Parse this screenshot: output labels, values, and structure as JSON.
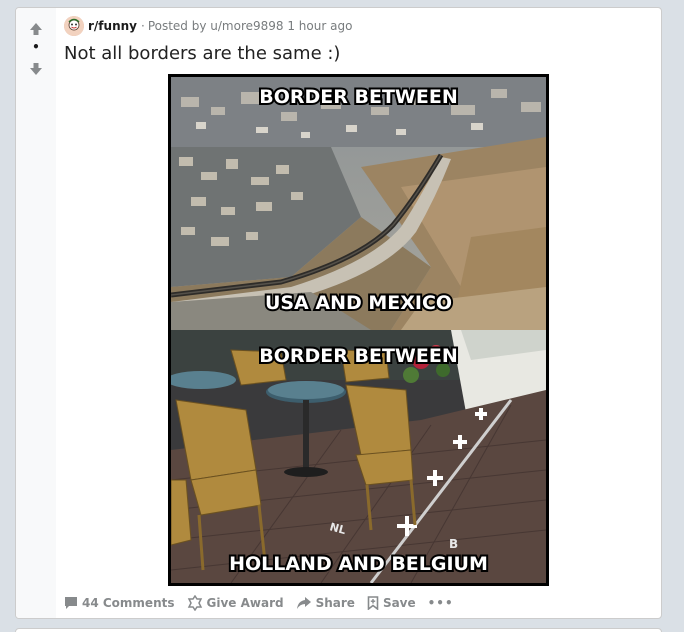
{
  "post": {
    "subreddit": "r/funny",
    "separator": "·",
    "posted_by": "Posted by u/more9898 1 hour ago",
    "score": "•",
    "title": "Not all borders are the same :)"
  },
  "meme": {
    "top_heading": "BORDER BETWEEN",
    "top_subject": "USA AND MEXICO",
    "bottom_heading": "BORDER BETWEEN",
    "bottom_subject": "HOLLAND AND BELGIUM",
    "ground_mark_nl": "NL",
    "ground_mark_b": "B"
  },
  "actions": {
    "comments": "44 Comments",
    "award": "Give Award",
    "share": "Share",
    "save": "Save",
    "more": "•••"
  },
  "colors": {
    "page_bg": "#dae0e6",
    "card_bg": "#ffffff",
    "vote_rail": "#f8f9fa",
    "action_text": "#878a8c"
  },
  "icons": {
    "upvote": "arrow-up-icon",
    "downvote": "arrow-down-icon",
    "comments": "comment-bubble-icon",
    "award": "award-icon",
    "share": "share-arrow-icon",
    "save": "bookmark-icon"
  }
}
